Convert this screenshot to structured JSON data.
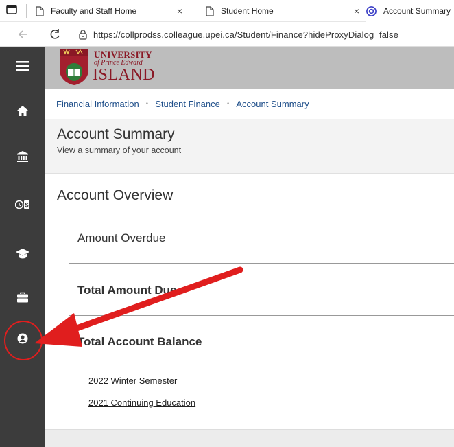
{
  "browser": {
    "tabs": [
      {
        "label": "Faculty and Staff Home",
        "close": "×"
      },
      {
        "label": "Student Home",
        "close": "×"
      },
      {
        "label": "Account Summary",
        "active": true
      }
    ],
    "url": "https://collprodss.colleague.upei.ca/Student/Finance?hideProxyDialog=false"
  },
  "logo": {
    "line1": "UNIVERSITY",
    "line2": "of Prince Edward",
    "line3": "ISLAND"
  },
  "breadcrumb": {
    "items": [
      "Financial Information",
      "Student Finance"
    ],
    "current": "Account Summary",
    "separator": "•"
  },
  "page": {
    "title": "Account Summary",
    "subtitle": "View a summary of your account"
  },
  "overview": {
    "title": "Account Overview",
    "rows": [
      {
        "label": "Amount Overdue"
      },
      {
        "label": "Total Amount Due"
      },
      {
        "label": "Total Account Balance"
      }
    ],
    "terms": [
      "2022 Winter Semester",
      "2021 Continuing Education"
    ]
  },
  "sidebar": {
    "icons": [
      "menu-icon",
      "home-icon",
      "bank-icon",
      "clock-dollar-icon",
      "graduation-cap-icon",
      "briefcase-icon",
      "user-icon"
    ]
  },
  "colors": {
    "sidebar": "#3c3c3c",
    "banner": "#bdbdbd",
    "link": "#1f4f8a",
    "annotation": "#e01e1e"
  }
}
